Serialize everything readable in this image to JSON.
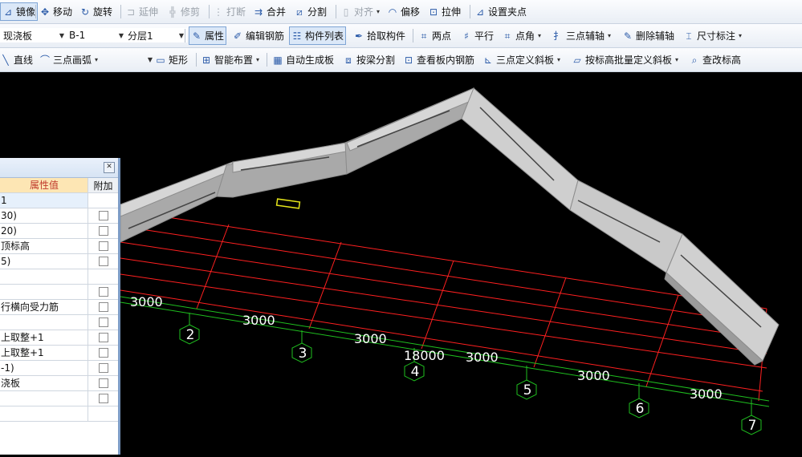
{
  "toolbar1": {
    "mirror": "镜像",
    "move": "移动",
    "rotate": "旋转",
    "extend": "延伸",
    "trim": "修剪",
    "break": "打断",
    "merge": "合并",
    "split": "分割",
    "align": "对齐",
    "offset": "偏移",
    "stretch": "拉伸",
    "set_grip": "设置夹点"
  },
  "toolbar2": {
    "component_type": "现浇板",
    "component_name": "B-1",
    "floor": "分层1",
    "properties": "属性",
    "edit_rebar": "编辑钢筋",
    "component_list": "构件列表",
    "pick_component": "拾取构件",
    "two_points": "两点",
    "parallel": "平行",
    "point_angle": "点角",
    "three_point_axis": "三点辅轴",
    "delete_axis": "删除辅轴",
    "dimension": "尺寸标注"
  },
  "toolbar3": {
    "line": "直线",
    "three_point_arc": "三点画弧",
    "arc_option": "",
    "rectangle": "矩形",
    "smart_layout": "智能布置",
    "auto_slab": "自动生成板",
    "split_by_beam": "按梁分割",
    "view_slab_rebar": "查看板内钢筋",
    "three_point_slope": "三点定义斜板",
    "batch_slope_by_elev": "按标高批量定义斜板",
    "check_elevation": "查改标高"
  },
  "properties_panel": {
    "col_value": "属性值",
    "col_extra": "附加",
    "rows": [
      {
        "value": "1"
      },
      {
        "value": "30)"
      },
      {
        "value": "20)"
      },
      {
        "value": "顶标高"
      },
      {
        "value": "5)"
      },
      {
        "value": ""
      },
      {
        "value": ""
      },
      {
        "value": "行横向受力筋"
      },
      {
        "value": ""
      },
      {
        "value": "上取整+1"
      },
      {
        "value": "上取整+1"
      },
      {
        "value": "-1)"
      },
      {
        "value": "浇板"
      },
      {
        "value": ""
      },
      {
        "value": ""
      }
    ]
  },
  "viewport": {
    "dimensions": [
      "3000",
      "3000",
      "3000",
      "18000",
      "3000",
      "3000",
      "3000"
    ],
    "axis_labels": [
      "2",
      "3",
      "4",
      "5",
      "6",
      "7"
    ],
    "colors": {
      "grid": "#ff2020",
      "dimension_line": "#1fbf1f",
      "axis_bubble": "#1fbf1f",
      "slab_top": "#d6d6d6",
      "slab_side": "#a9a9a9",
      "background": "#000000"
    }
  }
}
